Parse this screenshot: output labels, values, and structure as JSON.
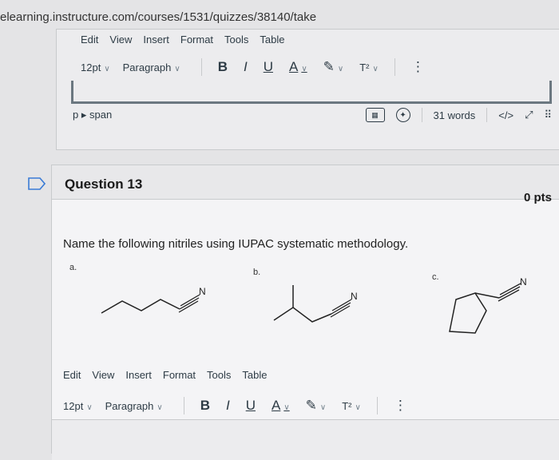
{
  "browser": {
    "url": "elearning.instructure.com/courses/1531/quizzes/38140/take"
  },
  "editor_top": {
    "menu": [
      "Edit",
      "View",
      "Insert",
      "Format",
      "Tools",
      "Table"
    ],
    "font_size": "12pt",
    "block_format": "Paragraph",
    "bold": "B",
    "italic": "I",
    "underline": "U",
    "text_color": "A",
    "superscript": "T²",
    "more": "⋮",
    "path": "p ▸ span",
    "word_count": "31 words",
    "html_toggle": "</>",
    "expand": "⤢",
    "drag": "⠿"
  },
  "question": {
    "title": "Question 13",
    "points": "0 pts",
    "prompt": "Name the following nitriles using IUPAC systematic methodology.",
    "labels": [
      "a.",
      "b.",
      "c."
    ],
    "atom": "N"
  },
  "editor_bottom": {
    "menu": [
      "Edit",
      "View",
      "Insert",
      "Format",
      "Tools",
      "Table"
    ],
    "font_size": "12pt",
    "block_format": "Paragraph",
    "bold": "B",
    "italic": "I",
    "underline": "U",
    "text_color": "A",
    "superscript": "T²",
    "more": "⋮"
  }
}
